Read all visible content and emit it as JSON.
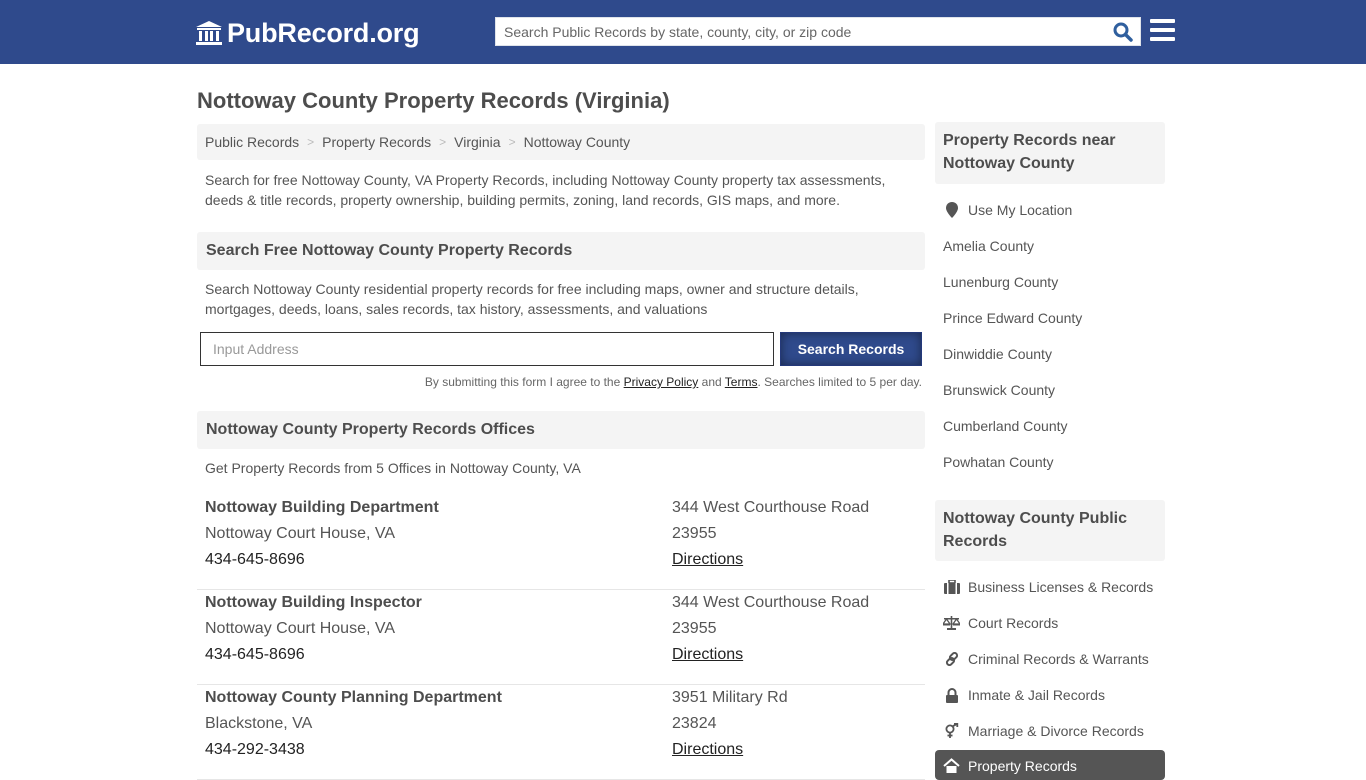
{
  "header": {
    "logo_text": "PubRecord.org",
    "logo_icon": "courthouse-icon",
    "search_placeholder": "Search Public Records by state, county, city, or zip code",
    "search_icon": "search-icon",
    "menu_icon": "hamburger-menu-icon",
    "brand_color": "#2f4a8c"
  },
  "page": {
    "title": "Nottoway County Property Records (Virginia)",
    "breadcrumb": [
      "Public Records",
      "Property Records",
      "Virginia",
      "Nottoway County"
    ],
    "breadcrumb_separator": ">",
    "intro": "Search for free Nottoway County, VA Property Records, including Nottoway County property tax assessments, deeds & title records, property ownership, building permits, zoning, land records, GIS maps, and more."
  },
  "search_section": {
    "heading": "Search Free Nottoway County Property Records",
    "description": "Search Nottoway County residential property records for free including maps, owner and structure details, mortgages, deeds, loans, sales records, tax history, assessments, and valuations",
    "input_placeholder": "Input Address",
    "button_label": "Search Records",
    "disclaimer_prefix": "By submitting this form I agree to the ",
    "privacy_link": "Privacy Policy",
    "and_text": " and ",
    "terms_link": "Terms",
    "disclaimer_suffix": ". Searches limited to 5 per day."
  },
  "offices_section": {
    "heading": "Nottoway County Property Records Offices",
    "description": "Get Property Records from 5 Offices in Nottoway County, VA",
    "offices": [
      {
        "name": "Nottoway Building Department",
        "city": "Nottoway Court House, VA",
        "phone": "434-645-8696",
        "address": "344 West Courthouse Road",
        "zip": "23955",
        "directions": "Directions"
      },
      {
        "name": "Nottoway Building Inspector",
        "city": "Nottoway Court House, VA",
        "phone": "434-645-8696",
        "address": "344 West Courthouse Road",
        "zip": "23955",
        "directions": "Directions"
      },
      {
        "name": "Nottoway County Planning Department",
        "city": "Blackstone, VA",
        "phone": "434-292-3438",
        "address": "3951 Military Rd",
        "zip": "23824",
        "directions": "Directions"
      }
    ]
  },
  "sidebar": {
    "nearby_heading": "Property Records near Nottoway County",
    "use_location": {
      "label": "Use My Location",
      "icon": "map-marker-icon"
    },
    "nearby_counties": [
      "Amelia County",
      "Lunenburg County",
      "Prince Edward County",
      "Dinwiddie County",
      "Brunswick County",
      "Cumberland County",
      "Powhatan County"
    ],
    "public_records_heading": "Nottoway County Public Records",
    "public_records": [
      {
        "label": "Business Licenses & Records",
        "icon": "briefcase-icon"
      },
      {
        "label": "Court Records",
        "icon": "scales-icon"
      },
      {
        "label": "Criminal Records & Warrants",
        "icon": "link-icon"
      },
      {
        "label": "Inmate & Jail Records",
        "icon": "lock-icon"
      },
      {
        "label": "Marriage & Divorce Records",
        "icon": "gender-icon"
      }
    ],
    "active_item": {
      "label": "Property Records",
      "icon": "home-icon"
    }
  }
}
